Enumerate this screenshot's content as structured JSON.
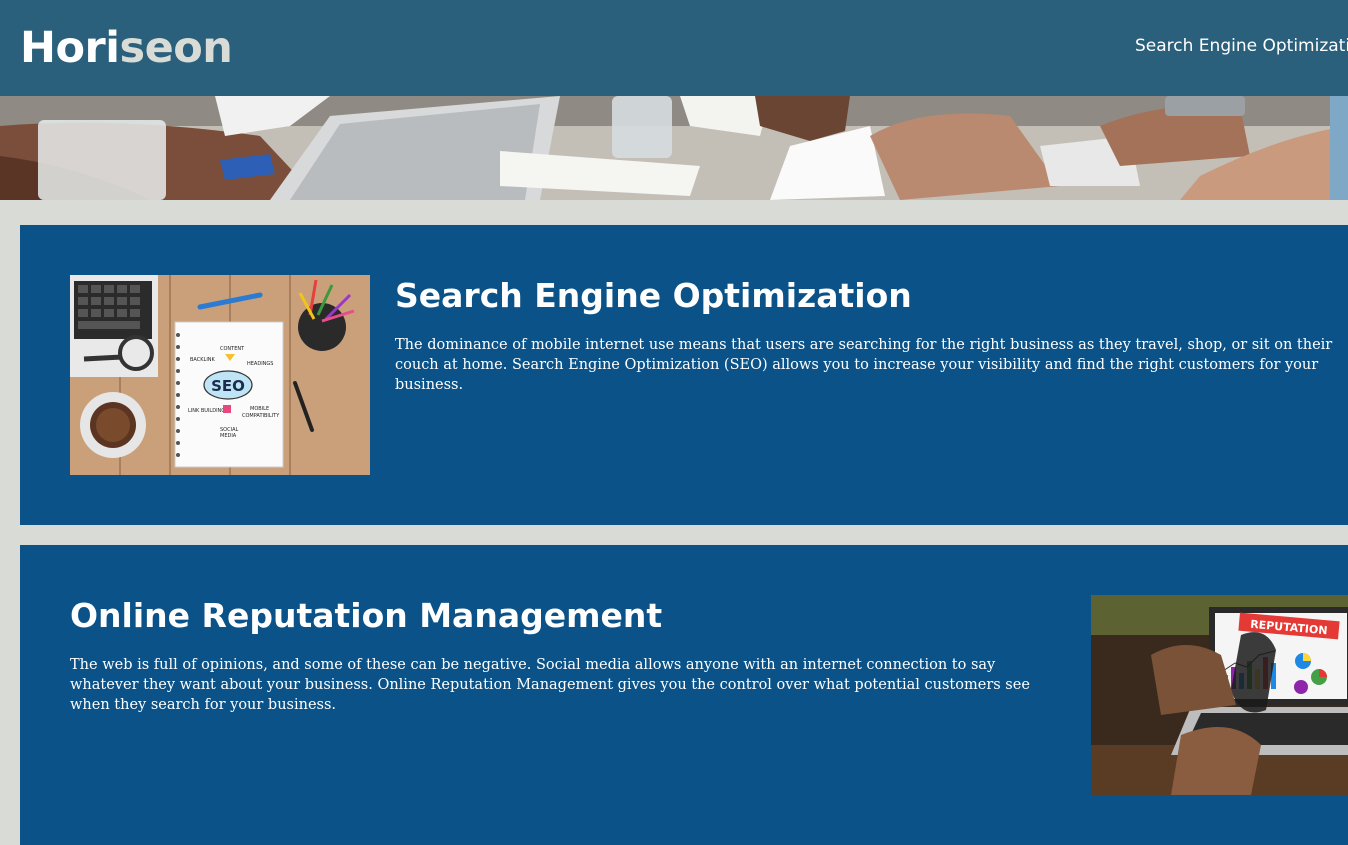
{
  "header": {
    "logo_part1": "Hori",
    "logo_part2": "seon",
    "nav_item": "Search Engine Optimization"
  },
  "sections": [
    {
      "title": "Search Engine Optimization",
      "text": "The dominance of mobile internet use means that users are searching for the right business as they travel, shop, or sit on their couch at home. Search Engine Optimization (SEO) allows you to increase your visibility and find the right customers for your business.",
      "image_labels": {
        "seo": "SEO",
        "content": "CONTENT",
        "backlink": "BACKLINK",
        "headings": "HEADINGS",
        "link_building": "LINK BUILDING",
        "mobile": "MOBILE",
        "compatibility": "COMPATIBILITY",
        "social": "SOCIAL",
        "media": "MEDIA"
      }
    },
    {
      "title": "Online Reputation Management",
      "text": "The web is full of opinions, and some of these can be negative. Social media allows anyone with an internet connection to say whatever they want about your business. Online Reputation Management gives you the control over what potential customers see when they search for your business.",
      "image_labels": {
        "banner": "REPUTATION"
      }
    }
  ],
  "colors": {
    "header_bg": "#2a607c",
    "page_bg": "#d9dcd6",
    "card_bg": "#0a5287",
    "text": "#ffffff"
  }
}
